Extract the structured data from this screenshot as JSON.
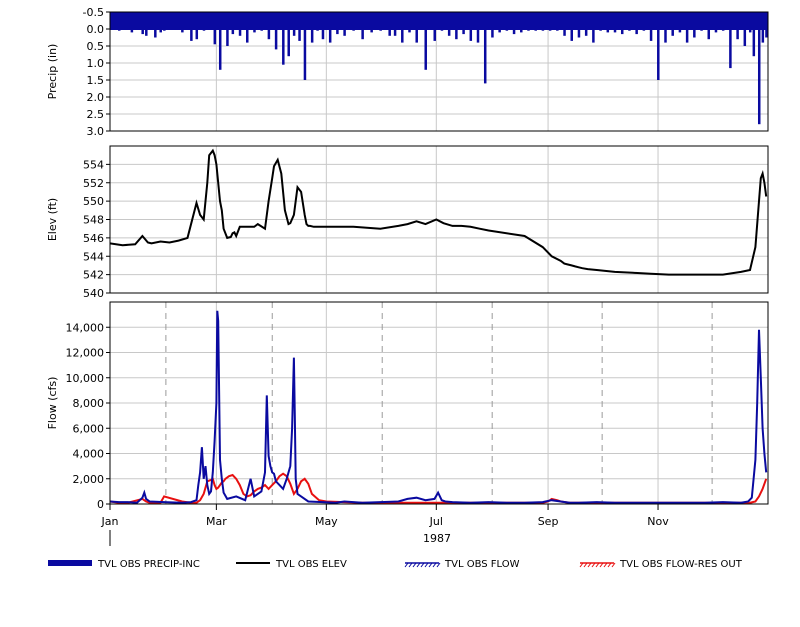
{
  "chart_data": [
    {
      "type": "bar",
      "panel": "precip",
      "ylabel": "Precip (in)",
      "ylim": [
        -0.5,
        3.0
      ],
      "y_inverted": true,
      "yticks": [
        "-0.5",
        "0.0",
        "0.5",
        "1.0",
        "1.5",
        "2.0",
        "2.5",
        "3.0"
      ],
      "grid": true,
      "series": [
        {
          "name": "TVL OBS PRECIP-INC",
          "color": "#0a0aa0",
          "day_of_year": [
            5,
            12,
            18,
            20,
            25,
            28,
            30,
            40,
            45,
            48,
            52,
            58,
            61,
            65,
            68,
            72,
            76,
            80,
            84,
            88,
            92,
            96,
            99,
            102,
            105,
            108,
            112,
            115,
            118,
            122,
            126,
            130,
            135,
            140,
            145,
            150,
            155,
            158,
            162,
            166,
            170,
            175,
            180,
            184,
            188,
            192,
            196,
            200,
            204,
            208,
            212,
            216,
            220,
            224,
            228,
            232,
            236,
            240,
            244,
            248,
            252,
            256,
            260,
            264,
            268,
            272,
            276,
            280,
            284,
            288,
            292,
            296,
            300,
            304,
            308,
            312,
            316,
            320,
            324,
            328,
            332,
            336,
            340,
            344,
            348,
            352,
            355,
            357,
            360,
            362,
            364
          ],
          "values": [
            0.05,
            0.1,
            0.15,
            0.2,
            0.25,
            0.1,
            0.05,
            0.1,
            0.35,
            0.3,
            0.05,
            0.45,
            1.2,
            0.5,
            0.15,
            0.2,
            0.4,
            0.1,
            0.05,
            0.3,
            0.6,
            1.05,
            0.8,
            0.2,
            0.35,
            1.5,
            0.4,
            0.05,
            0.3,
            0.4,
            0.15,
            0.2,
            0.05,
            0.3,
            0.1,
            0.05,
            0.2,
            0.2,
            0.4,
            0.1,
            0.4,
            1.2,
            0.35,
            0.05,
            0.2,
            0.3,
            0.15,
            0.35,
            0.4,
            1.6,
            0.25,
            0.1,
            0.05,
            0.15,
            0.1,
            0.05,
            0.05,
            0.05,
            0.05,
            0.05,
            0.2,
            0.35,
            0.25,
            0.2,
            0.4,
            0.05,
            0.1,
            0.1,
            0.15,
            0.05,
            0.15,
            0.05,
            0.35,
            1.5,
            0.4,
            0.2,
            0.1,
            0.4,
            0.25,
            0.05,
            0.3,
            0.1,
            0.05,
            1.15,
            0.3,
            0.5,
            0.1,
            0.8,
            2.8,
            0.4,
            0.25
          ]
        }
      ]
    },
    {
      "type": "line",
      "panel": "elev",
      "ylabel": "Elev (ft)",
      "ylim": [
        540,
        556
      ],
      "yticks": [
        "540",
        "542",
        "544",
        "546",
        "548",
        "550",
        "552",
        "554"
      ],
      "grid": true,
      "series": [
        {
          "name": "TVL OBS ELEV",
          "color": "#000000",
          "day_of_year": [
            0,
            7,
            14,
            18,
            21,
            23,
            28,
            33,
            38,
            43,
            48,
            50,
            52,
            53,
            54,
            55,
            57,
            58,
            59,
            60,
            61,
            62,
            63,
            65,
            67,
            68,
            69,
            70,
            72,
            74,
            80,
            82,
            86,
            88,
            90,
            91,
            93,
            95,
            97,
            99,
            100,
            102,
            104,
            106,
            108,
            109,
            110,
            111,
            113,
            116,
            125,
            135,
            150,
            160,
            165,
            170,
            175,
            181,
            185,
            190,
            195,
            200,
            205,
            210,
            230,
            240,
            245,
            250,
            252,
            254,
            256,
            258,
            260,
            262,
            265,
            270,
            280,
            290,
            300,
            310,
            320,
            330,
            340,
            350,
            355,
            358,
            360,
            361,
            362,
            363,
            364
          ],
          "values": [
            545.4,
            545.2,
            545.3,
            546.2,
            545.5,
            545.4,
            545.6,
            545.5,
            545.7,
            546.0,
            549.8,
            548.5,
            548.0,
            550.0,
            552.0,
            555.0,
            555.5,
            555.0,
            554.0,
            552.0,
            550.0,
            549.0,
            547.0,
            546.0,
            546.1,
            546.5,
            546.6,
            546.2,
            547.2,
            547.2,
            547.2,
            547.5,
            547.0,
            550.0,
            552.5,
            553.8,
            554.5,
            553.0,
            549.0,
            547.5,
            547.6,
            548.5,
            551.5,
            551.0,
            548.5,
            547.5,
            547.3,
            547.3,
            547.2,
            547.2,
            547.2,
            547.2,
            547.0,
            547.3,
            547.5,
            547.8,
            547.5,
            548.0,
            547.6,
            547.3,
            547.3,
            547.2,
            547.0,
            546.8,
            546.2,
            545.0,
            544.0,
            543.5,
            543.2,
            543.1,
            543.0,
            542.9,
            542.8,
            542.7,
            542.6,
            542.5,
            542.3,
            542.2,
            542.1,
            542.0,
            542.0,
            542.0,
            542.0,
            542.3,
            542.5,
            545.0,
            550.0,
            552.5,
            553.0,
            552.0,
            550.5
          ]
        }
      ]
    },
    {
      "type": "line",
      "panel": "flow",
      "ylabel": "Flow (cfs)",
      "ylim": [
        0,
        16000
      ],
      "yticks": [
        "0",
        "2,000",
        "4,000",
        "6,000",
        "8,000",
        "10,000",
        "12,000",
        "14,000"
      ],
      "xlabel": "1987",
      "xticks": [
        "Jan",
        "Mar",
        "May",
        "Jul",
        "Sep",
        "Nov"
      ],
      "xtick_day_of_year": [
        0,
        59,
        120,
        181,
        243,
        304
      ],
      "grid": true,
      "series": [
        {
          "name": "TVL OBS FLOW",
          "color": "#0a0aa0",
          "day_of_year": [
            0,
            5,
            10,
            15,
            18,
            19,
            20,
            22,
            30,
            40,
            45,
            48,
            49,
            50,
            51,
            52,
            53,
            54,
            55,
            56,
            57,
            58,
            59,
            59.5,
            60,
            60.5,
            61,
            62,
            63,
            65,
            70,
            75,
            78,
            80,
            82,
            84,
            86,
            87,
            88,
            89,
            90,
            91,
            92,
            94,
            96,
            98,
            100,
            101,
            102,
            102.5,
            103,
            104,
            106,
            110,
            118,
            125,
            130,
            140,
            150,
            160,
            165,
            170,
            175,
            180,
            182,
            183,
            184,
            186,
            190,
            200,
            210,
            220,
            230,
            240,
            245,
            250,
            255,
            260,
            270,
            280,
            290,
            300,
            310,
            320,
            330,
            340,
            350,
            354,
            356,
            357,
            358,
            359,
            360,
            361,
            362,
            363,
            364
          ],
          "values": [
            200,
            150,
            150,
            100,
            500,
            900,
            400,
            200,
            150,
            100,
            150,
            300,
            1500,
            2500,
            4500,
            2000,
            3000,
            1500,
            800,
            1000,
            2500,
            5000,
            8000,
            15300,
            14500,
            9000,
            3500,
            2000,
            900,
            400,
            600,
            300,
            2000,
            600,
            800,
            1000,
            2500,
            8600,
            3800,
            3000,
            2500,
            2400,
            1800,
            1500,
            1200,
            2000,
            3000,
            6000,
            11600,
            7000,
            2000,
            800,
            600,
            200,
            150,
            100,
            200,
            100,
            150,
            200,
            400,
            500,
            300,
            400,
            900,
            600,
            300,
            200,
            150,
            100,
            150,
            100,
            100,
            150,
            300,
            200,
            100,
            100,
            150,
            100,
            100,
            100,
            100,
            100,
            100,
            150,
            100,
            200,
            500,
            2000,
            3500,
            8000,
            13800,
            10000,
            6000,
            4000,
            2500,
            1500,
            1000
          ]
        },
        {
          "name": "TVL OBS FLOW-RES OUT",
          "color": "#e81010",
          "day_of_year": [
            0,
            5,
            10,
            18,
            20,
            22,
            28,
            30,
            40,
            45,
            48,
            50,
            52,
            54,
            56,
            57,
            58,
            59,
            60,
            61,
            62,
            63,
            64,
            66,
            68,
            70,
            72,
            74,
            76,
            78,
            80,
            82,
            84,
            86,
            88,
            90,
            92,
            94,
            96,
            98,
            100,
            102,
            104,
            106,
            108,
            110,
            112,
            116,
            120,
            130,
            140,
            150,
            160,
            180,
            200,
            220,
            240,
            243,
            245,
            248,
            250,
            255,
            260,
            270,
            280,
            290,
            300,
            310,
            320,
            330,
            340,
            350,
            355,
            358,
            360,
            362,
            364
          ],
          "values": [
            200,
            100,
            100,
            400,
            200,
            100,
            100,
            600,
            200,
            100,
            100,
            300,
            800,
            1800,
            1900,
            2000,
            1500,
            1200,
            1300,
            1500,
            1700,
            1800,
            2000,
            2200,
            2300,
            2000,
            1500,
            800,
            600,
            700,
            1000,
            1200,
            1300,
            1500,
            1200,
            1500,
            1800,
            2200,
            2400,
            2200,
            1600,
            800,
            1200,
            1800,
            2000,
            1600,
            800,
            300,
            200,
            150,
            100,
            100,
            100,
            100,
            100,
            100,
            100,
            200,
            400,
            300,
            200,
            100,
            100,
            100,
            100,
            100,
            100,
            100,
            100,
            100,
            100,
            100,
            100,
            200,
            600,
            1200,
            2000
          ]
        }
      ]
    }
  ],
  "legend": [
    {
      "name": "TVL OBS PRECIP-INC",
      "style": "thick-bar",
      "color": "#0a0aa0"
    },
    {
      "name": "TVL OBS ELEV",
      "style": "line",
      "color": "#000000"
    },
    {
      "name": "TVL OBS FLOW",
      "style": "hatched-line",
      "color": "#0a0aa0"
    },
    {
      "name": "TVL OBS FLOW-RES OUT",
      "style": "hatched-line",
      "color": "#e81010"
    }
  ],
  "colors": {
    "grid": "#c8c8c8",
    "frame": "#000000",
    "precip": "#0a0aa0",
    "elev": "#000000",
    "flow": "#0a0aa0",
    "resout": "#e81010"
  }
}
